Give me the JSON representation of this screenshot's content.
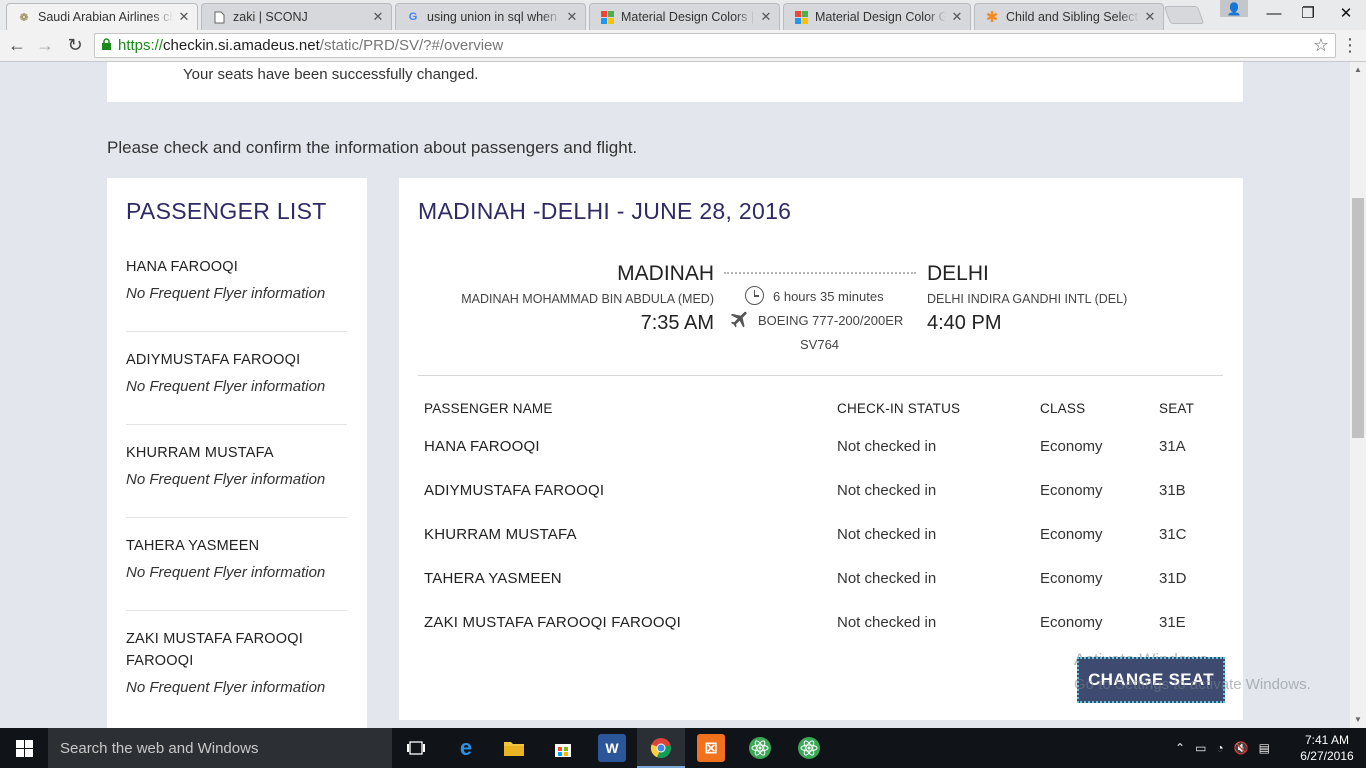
{
  "browser": {
    "tabs": [
      {
        "title": "Saudi Arabian Airlines che",
        "active": true,
        "favicon": "airline-emblem-icon"
      },
      {
        "title": "zaki | SCONJ",
        "active": false,
        "favicon": "page-icon"
      },
      {
        "title": "using union in sql when u",
        "active": false,
        "favicon": "google-icon"
      },
      {
        "title": "Material Design Colors | M",
        "active": false,
        "favicon": "palette-icon"
      },
      {
        "title": "Material Design Color Gre",
        "active": false,
        "favicon": "palette-icon"
      },
      {
        "title": "Child and Sibling Selector",
        "active": false,
        "favicon": "asterisk-icon"
      }
    ],
    "url_secure": "https://",
    "url_host": "checkin.si.amadeus.net",
    "url_path": "/static/PRD/SV/?#/overview"
  },
  "page": {
    "notice": "Your seats have been successfully changed.",
    "intro": "Please check and confirm the information about passengers and flight."
  },
  "passenger_list": {
    "title": "PASSENGER LIST",
    "items": [
      {
        "name": "HANA FAROOQI",
        "ff": "No Frequent Flyer information"
      },
      {
        "name": "ADIYMUSTAFA FAROOQI",
        "ff": "No Frequent Flyer information"
      },
      {
        "name": "KHURRAM MUSTAFA",
        "ff": "No Frequent Flyer information"
      },
      {
        "name": "TAHERA YASMEEN",
        "ff": "No Frequent Flyer information"
      },
      {
        "name": "ZAKI MUSTAFA FAROOQI FAROOQI",
        "ff": "No Frequent Flyer information"
      }
    ]
  },
  "flight": {
    "title": "MADINAH -DELHI - JUNE 28, 2016",
    "departure": {
      "city": "MADINAH",
      "airport": "MADINAH MOHAMMAD BIN ABDULA (MED)",
      "time": "7:35 AM"
    },
    "arrival": {
      "city": "DELHI",
      "airport": "DELHI INDIRA GANDHI INTL (DEL)",
      "time": "4:40 PM"
    },
    "duration": "6 hours 35 minutes",
    "aircraft": "BOEING 777-200/200ER",
    "flight_number": "SV764"
  },
  "table": {
    "headers": [
      "PASSENGER NAME",
      "CHECK-IN STATUS",
      "CLASS",
      "SEAT"
    ],
    "rows": [
      {
        "name": "HANA FAROOQI",
        "status": "Not checked in",
        "class": "Economy",
        "seat": "31A"
      },
      {
        "name": "ADIYMUSTAFA FAROOQI",
        "status": "Not checked in",
        "class": "Economy",
        "seat": "31B"
      },
      {
        "name": "KHURRAM MUSTAFA",
        "status": "Not checked in",
        "class": "Economy",
        "seat": "31C"
      },
      {
        "name": "TAHERA YASMEEN",
        "status": "Not checked in",
        "class": "Economy",
        "seat": "31D"
      },
      {
        "name": "ZAKI MUSTAFA FAROOQI FAROOQI",
        "status": "Not checked in",
        "class": "Economy",
        "seat": "31E"
      }
    ]
  },
  "actions": {
    "change_seat": "CHANGE SEAT"
  },
  "watermark": {
    "line1": "Activate Windows",
    "line2": "Go to Settings to activate Windows."
  },
  "taskbar": {
    "search_placeholder": "Search the web and Windows",
    "time": "7:41 AM",
    "date": "6/27/2016"
  },
  "colors": {
    "brand_navy": "#2e2a66",
    "button": "#3e4a70",
    "secure_green": "#1a8a1a"
  }
}
